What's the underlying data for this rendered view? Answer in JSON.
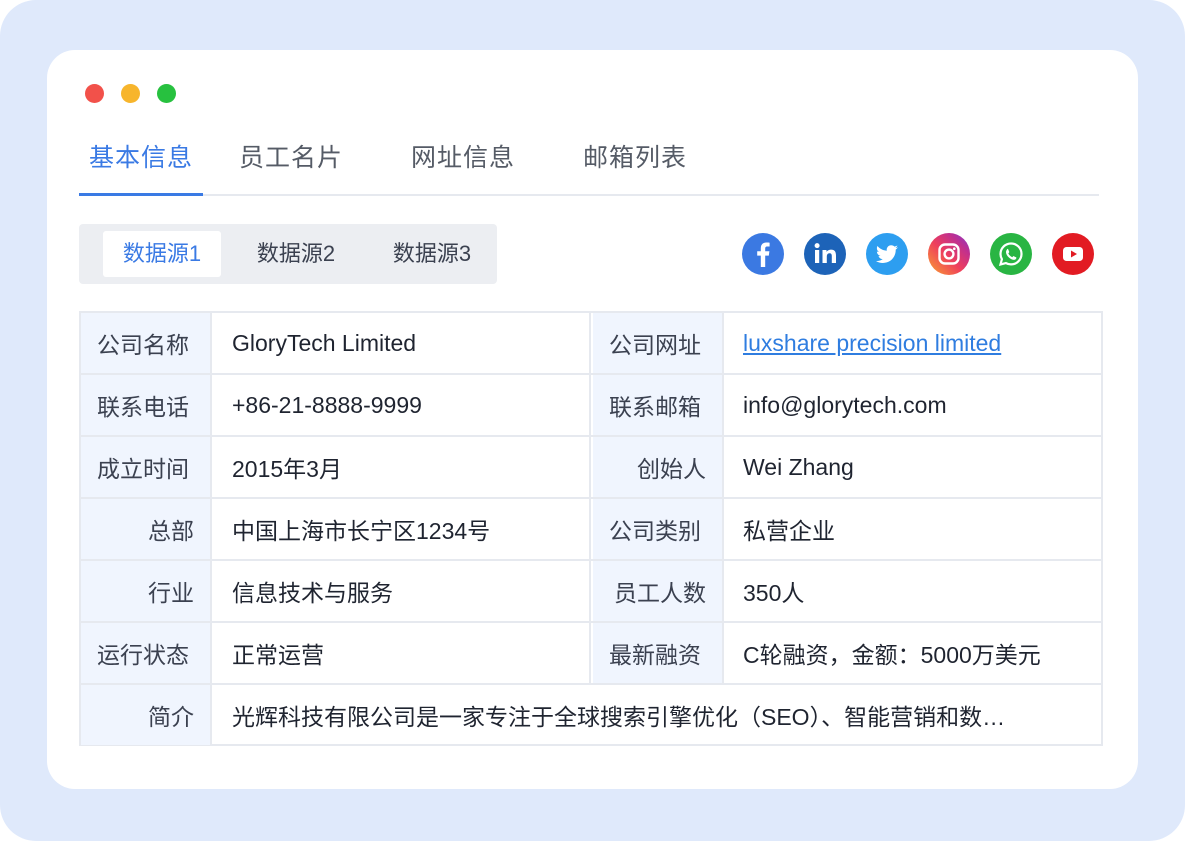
{
  "tabs": [
    {
      "label": "基本信息",
      "active": true
    },
    {
      "label": "员工名片",
      "active": false
    },
    {
      "label": "网址信息",
      "active": false
    },
    {
      "label": "邮箱列表",
      "active": false
    }
  ],
  "data_sources": [
    {
      "label": "数据源1",
      "active": true
    },
    {
      "label": "数据源2",
      "active": false
    },
    {
      "label": "数据源3",
      "active": false
    }
  ],
  "socials": [
    {
      "icon": "facebook-icon",
      "color": "#3b79e2"
    },
    {
      "icon": "linkedin-icon",
      "color": "#1d63b8"
    },
    {
      "icon": "twitter-icon",
      "color": "#2d9ef0"
    },
    {
      "icon": "instagram-icon",
      "color": "#e2336b"
    },
    {
      "icon": "whatsapp-icon",
      "color": "#29b543"
    },
    {
      "icon": "youtube-icon",
      "color": "#e21b23"
    }
  ],
  "info": {
    "company_name_label": "公司名称",
    "company_name": "GloryTech Limited",
    "website_label": "公司网址",
    "website": "luxshare precision limited",
    "phone_label": "联系电话",
    "phone": "+86-21-8888-9999",
    "email_label": "联系邮箱",
    "email": "info@glorytech.com",
    "founded_label": "成立时间",
    "founded": "2015年3月",
    "founder_label": "创始人",
    "founder": "Wei Zhang",
    "hq_label": "总部",
    "hq": "中国上海市长宁区1234号",
    "category_label": "公司类别",
    "category": "私营企业",
    "industry_label": "行业",
    "industry": "信息技术与服务",
    "employees_label": "员工人数",
    "employees": "350人",
    "status_label": "运行状态",
    "status": "正常运营",
    "funding_label": "最新融资",
    "funding": "C轮融资，金额：5000万美元",
    "intro_label": "简介",
    "intro": "光辉科技有限公司是一家专注于全球搜索引擎优化（SEO）、智能营销和数…"
  },
  "colors": {
    "accent": "#3a7ae4",
    "label_bg": "#f0f5fe",
    "link": "#2f7de0"
  }
}
